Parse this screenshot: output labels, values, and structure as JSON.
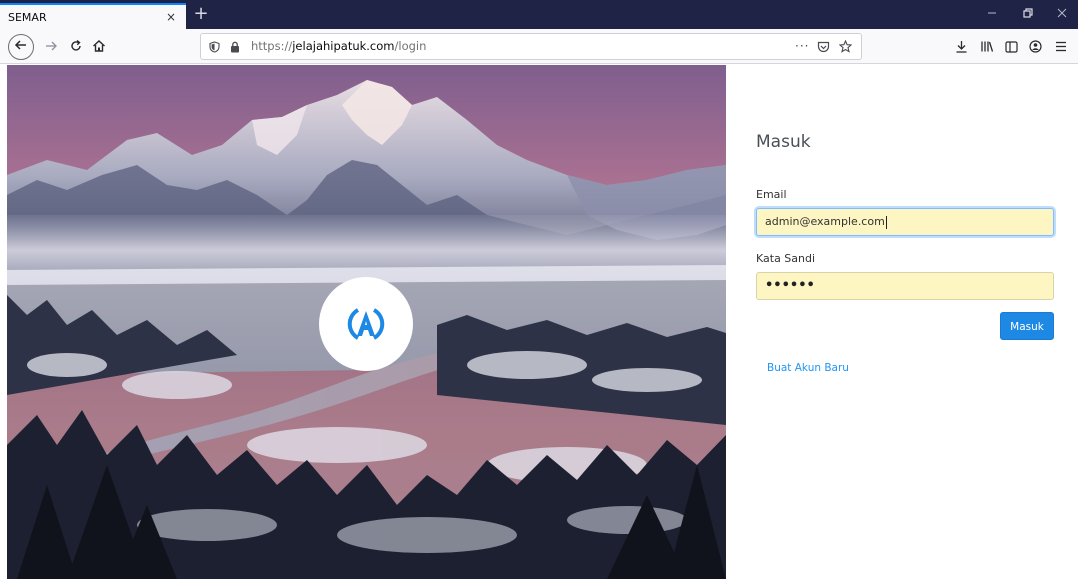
{
  "browser": {
    "tab_title": "SEMAR",
    "tab_close": "×",
    "new_tab": "+",
    "url_scheme": "https://",
    "url_host": "jelajahipatuk.com",
    "url_path": "/login"
  },
  "login": {
    "title": "Masuk",
    "email_label": "Email",
    "email_value": "admin@example.com",
    "password_label": "Kata Sandi",
    "password_value": "••••••",
    "submit_label": "Masuk",
    "register_link": "Buat Akun Baru"
  },
  "colors": {
    "titlebar": "#1f2447",
    "accent": "#1e88e5",
    "link": "#2196f3",
    "autofill": "#fdf6c3"
  },
  "icons": {
    "nav": [
      "back-arrow-icon",
      "forward-arrow-icon",
      "reload-icon",
      "home-icon"
    ],
    "url": [
      "tracking-shield-icon",
      "lock-icon",
      "page-actions-icon",
      "pocket-icon",
      "bookmark-star-icon"
    ],
    "toolbar": [
      "download-icon",
      "library-icon",
      "sidebar-icon",
      "account-icon",
      "menu-icon"
    ]
  }
}
